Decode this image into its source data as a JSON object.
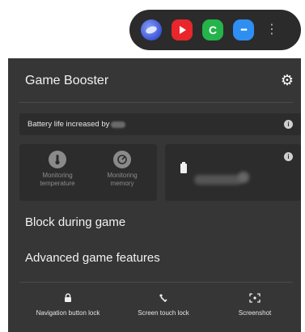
{
  "tray": {
    "apps": [
      {
        "name": "browser-app-icon"
      },
      {
        "name": "youtube-app-icon"
      },
      {
        "name": "phone-app-icon"
      },
      {
        "name": "messages-app-icon"
      }
    ],
    "more": "⋮"
  },
  "panel": {
    "title": "Game Booster",
    "settings_icon": "⚙",
    "battery_message": "Battery life increased by",
    "info_glyph": "i",
    "monitoring": [
      {
        "label": "Monitoring temperature",
        "line1": "Monitoring",
        "line2": "temperature",
        "glyph": "🌡"
      },
      {
        "label": "Monitoring memory",
        "line1": "Monitoring",
        "line2": "memory",
        "glyph": "◔"
      }
    ],
    "menu": {
      "block_during_game": "Block during game",
      "advanced_game_features": "Advanced game features"
    },
    "bottom_actions": [
      {
        "label": "Navigation button lock",
        "glyph": "🔒"
      },
      {
        "label": "Screen touch lock",
        "glyph": "☝"
      },
      {
        "label": "Screenshot",
        "glyph": "⌗"
      }
    ]
  },
  "colors": {
    "panel_bg": "#363636",
    "card_bg": "#2c2c2c",
    "tray_bg": "#2b2b2b"
  }
}
